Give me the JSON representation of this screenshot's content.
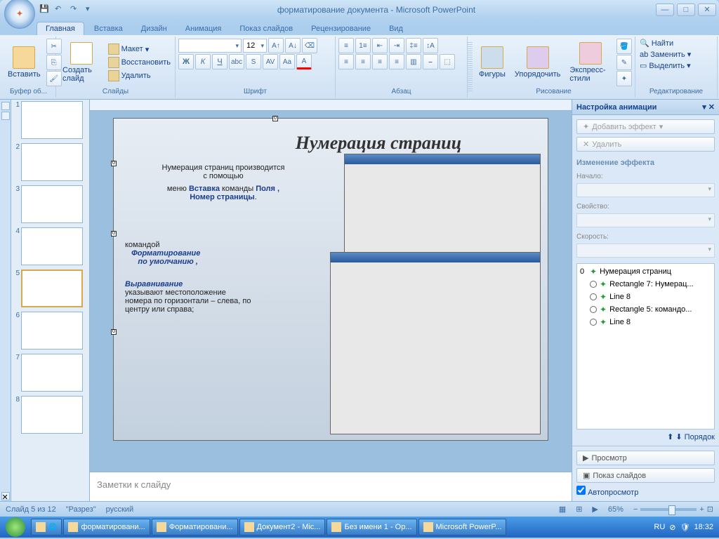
{
  "title": "форматирование документа - Microsoft PowerPoint",
  "qat": {
    "save": "💾",
    "undo": "↶",
    "redo": "↷"
  },
  "tabs": [
    "Главная",
    "Вставка",
    "Дизайн",
    "Анимация",
    "Показ слайдов",
    "Рецензирование",
    "Вид"
  ],
  "ribbon": {
    "clipboard": {
      "label": "Буфер об...",
      "paste": "Вставить"
    },
    "slides": {
      "label": "Слайды",
      "new": "Создать слайд",
      "layout": "Макет",
      "restore": "Восстановить",
      "delete": "Удалить"
    },
    "font": {
      "label": "Шрифт",
      "size": "12"
    },
    "paragraph": {
      "label": "Абзац"
    },
    "drawing": {
      "label": "Рисование",
      "shapes": "Фигуры",
      "arrange": "Упорядочить",
      "quick": "Экспресс-стили"
    },
    "editing": {
      "label": "Редактирование",
      "find": "Найти",
      "replace": "Заменить",
      "select": "Выделить"
    }
  },
  "thumbs": [
    1,
    2,
    3,
    4,
    5,
    6,
    7,
    8
  ],
  "selected_thumb": 5,
  "slide": {
    "title": "Нумерация страниц",
    "line1a": "Нумерация страниц производится",
    "line1b": "с помощью",
    "line2a": "меню ",
    "line2b": "Вставка",
    "line2c": " команды ",
    "line2d": "Поля ,",
    "line3": "Номер страницы",
    "line4a": "командой",
    "line4b": "Форматирование",
    "line4c": "по умолчанию ,",
    "line5": "Выравнивание",
    "line6": "указывают местоположение номера по горизонтали – слева, по центру или справа;"
  },
  "notes_placeholder": "Заметки к слайду",
  "anim": {
    "title": "Настройка анимации",
    "add": "Добавить эффект",
    "remove": "Удалить",
    "change": "Изменение эффекта",
    "start": "Начало:",
    "property": "Свойство:",
    "speed": "Скорость:",
    "effects": [
      {
        "n": "0",
        "label": "Нумерация страниц"
      },
      {
        "n": "",
        "label": "Rectangle 7: Нумерац..."
      },
      {
        "n": "",
        "label": "Line 8"
      },
      {
        "n": "",
        "label": "Rectangle 5:  командо..."
      },
      {
        "n": "",
        "label": "Line 8"
      }
    ],
    "order": "Порядок",
    "preview": "Просмотр",
    "slideshow": "Показ слайдов",
    "autopreview": "Автопросмотр"
  },
  "status": {
    "slide": "Слайд 5 из 12",
    "theme": "\"Разрез\"",
    "lang": "русский",
    "zoom": "65%"
  },
  "taskbar": {
    "items": [
      "форматировани...",
      "Форматировани...",
      "Документ2 - Mic...",
      "Без имени 1 - Op...",
      "Microsoft PowerP..."
    ],
    "lang": "RU",
    "time": "18:32"
  }
}
